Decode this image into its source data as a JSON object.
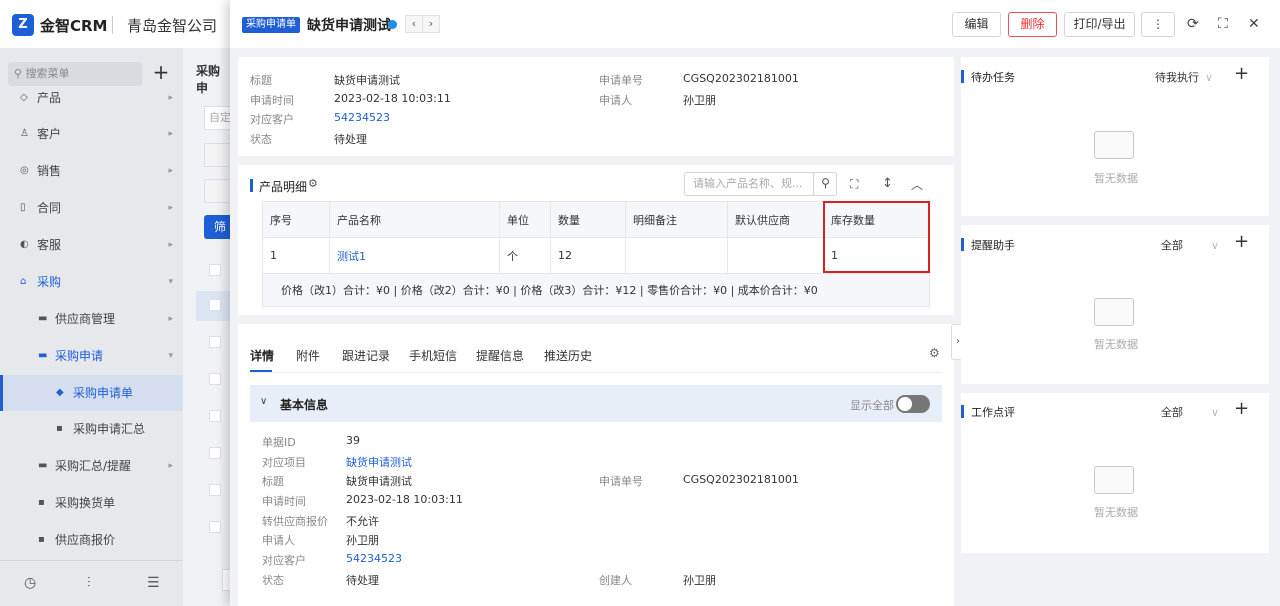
{
  "app": {
    "logo_mark": "Z",
    "logo_text": "金智CRM",
    "company": "青岛金智公司"
  },
  "sidebar": {
    "search_placeholder": "搜索菜单",
    "plus": "+",
    "items": [
      {
        "label": "产品",
        "icon": "◇"
      },
      {
        "label": "客户",
        "icon": "♙"
      },
      {
        "label": "销售",
        "icon": "◎"
      },
      {
        "label": "合同",
        "icon": "▯"
      },
      {
        "label": "客服",
        "icon": "◐"
      },
      {
        "label": "采购",
        "icon": "⌂"
      },
      {
        "label": "供应商管理",
        "icon": "▬"
      },
      {
        "label": "采购申请",
        "icon": "▬"
      },
      {
        "label": "采购申请单",
        "icon": "◆"
      },
      {
        "label": "采购申请汇总",
        "icon": "▪"
      },
      {
        "label": "采购汇总/提醒",
        "icon": "▬"
      },
      {
        "label": "采购换货单",
        "icon": "▪"
      },
      {
        "label": "供应商报价",
        "icon": "▪"
      }
    ],
    "bottom_icons": [
      "history-icon",
      "tune-icon",
      "menu-icon"
    ]
  },
  "bg": {
    "page_title": "采购申",
    "filter_btn": "筛",
    "filter_placeholder": "自定"
  },
  "header": {
    "tag": "采购申请单",
    "title": "缺货申请测试",
    "prev": "‹",
    "next": "›",
    "edit": "编辑",
    "delete": "删除",
    "print": "打印/导出",
    "more": "⋮"
  },
  "info": {
    "title_label": "标题",
    "title_value": "缺货申请测试",
    "time_label": "申请时间",
    "time_value": "2023-02-18 10:03:11",
    "customer_label": "对应客户",
    "customer_value": "54234523",
    "status_label": "状态",
    "status_value": "待处理",
    "no_label": "申请单号",
    "no_value": "CGSQ202302181001",
    "applicant_label": "申请人",
    "applicant_value": "孙卫朋"
  },
  "products": {
    "title": "产品明细",
    "search_placeholder": "请输入产品名称、规...",
    "columns": [
      "序号",
      "产品名称",
      "单位",
      "数量",
      "明细备注",
      "默认供应商",
      "库存数量"
    ],
    "rows": [
      [
        "1",
        "测试1",
        "个",
        "12",
        "",
        "",
        "1"
      ]
    ],
    "summary": "价格（改1）合计：¥0 |   价格（改2）合计：¥0 |   价格（改3）合计：¥12 |   零售价合计：¥0 |   成本价合计：¥0"
  },
  "tabs": [
    "详情",
    "附件",
    "跟进记录",
    "手机短信",
    "提醒信息",
    "推送历史"
  ],
  "basic": {
    "title": "基本信息",
    "show_all": "显示全部",
    "fields": [
      {
        "label": "单据ID",
        "value": "39"
      },
      {
        "label": "对应项目",
        "value": "缺货申请测试"
      },
      {
        "label": "标题",
        "value": "缺货申请测试"
      },
      {
        "label": "申请时间",
        "value": "2023-02-18 10:03:11"
      },
      {
        "label": "转供应商报价",
        "value": "不允许"
      },
      {
        "label": "申请人",
        "value": "孙卫朋"
      },
      {
        "label": "对应客户",
        "value": "54234523"
      },
      {
        "label": "状态",
        "value": "待处理"
      }
    ],
    "right": [
      {
        "label": "申请单号",
        "value": "CGSQ202302181001"
      },
      {
        "label": "创建人",
        "value": "孙卫朋"
      }
    ]
  },
  "right_panels": [
    {
      "title": "待办任务",
      "filter": "待我执行",
      "empty": "暂无数据"
    },
    {
      "title": "提醒助手",
      "filter": "全部",
      "empty": "暂无数据"
    },
    {
      "title": "工作点评",
      "filter": "全部",
      "empty": "暂无数据"
    }
  ]
}
